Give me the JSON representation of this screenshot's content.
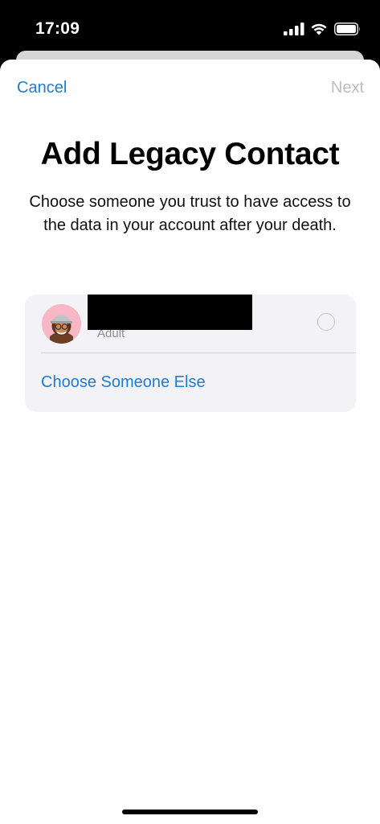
{
  "status_bar": {
    "time": "17:09",
    "icons": [
      "cellular-signal-icon",
      "wifi-icon",
      "battery-icon"
    ]
  },
  "nav": {
    "cancel_label": "Cancel",
    "next_label": "Next"
  },
  "title": "Add Legacy Contact",
  "subtitle": "Choose someone you trust to have access to the data in your account after your death.",
  "contacts": [
    {
      "name": "",
      "role": "Adult",
      "avatar": "memoji-avatar-icon",
      "selected": false
    }
  ],
  "choose_else_label": "Choose Someone Else",
  "colors": {
    "accent": "#1f7bd6",
    "disabled": "#bdbdc2",
    "card_bg": "#f2f2f7"
  }
}
